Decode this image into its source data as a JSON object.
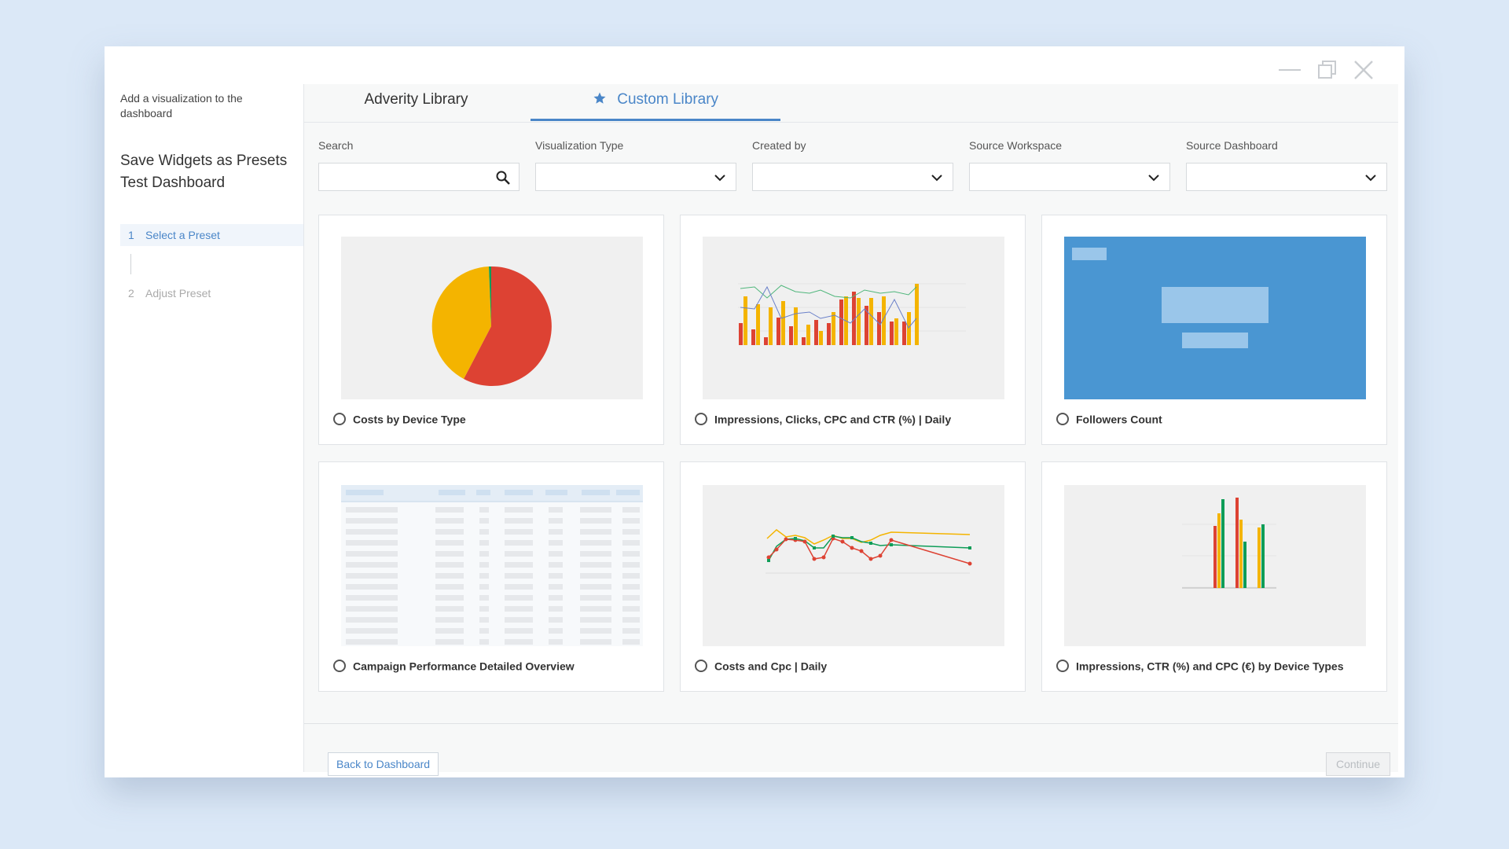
{
  "sidebar": {
    "hint": "Add a visualization to the dashboard",
    "title": "Save Widgets as Presets Test Dashboard",
    "steps": [
      {
        "num": "1",
        "label": "Select a Preset"
      },
      {
        "num": "2",
        "label": "Adjust Preset"
      }
    ]
  },
  "tabs": [
    {
      "label": "Adverity Library"
    },
    {
      "label": "Custom Library",
      "icon": "star-icon"
    }
  ],
  "filters": {
    "search": {
      "label": "Search",
      "value": "",
      "icon": "search-icon"
    },
    "visualization_type": {
      "label": "Visualization Type",
      "value": ""
    },
    "created_by": {
      "label": "Created by",
      "value": ""
    },
    "source_workspace": {
      "label": "Source Workspace",
      "value": ""
    },
    "source_dashboard": {
      "label": "Source Dashboard",
      "value": ""
    }
  },
  "presets": [
    {
      "label": "Costs by Device Type",
      "thumbnail": "pie-chart"
    },
    {
      "label": "Impressions, Clicks, CPC and CTR (%) | Daily",
      "thumbnail": "bar-line-chart"
    },
    {
      "label": "Followers Count",
      "thumbnail": "kpi-tile"
    },
    {
      "label": "Campaign Performance Detailed Overview",
      "thumbnail": "table"
    },
    {
      "label": "Costs and Cpc | Daily",
      "thumbnail": "line-chart"
    },
    {
      "label": "Impressions, CTR (%) and CPC (€) by Device Types",
      "thumbnail": "grouped-bar-chart"
    }
  ],
  "footer": {
    "back_label": "Back to Dashboard",
    "continue_label": "Continue"
  },
  "colors": {
    "accent": "#4a86c8",
    "red": "#dd4233",
    "yellow": "#f4b400",
    "green": "#0f9d58",
    "tile_blue": "#4a96d2"
  }
}
